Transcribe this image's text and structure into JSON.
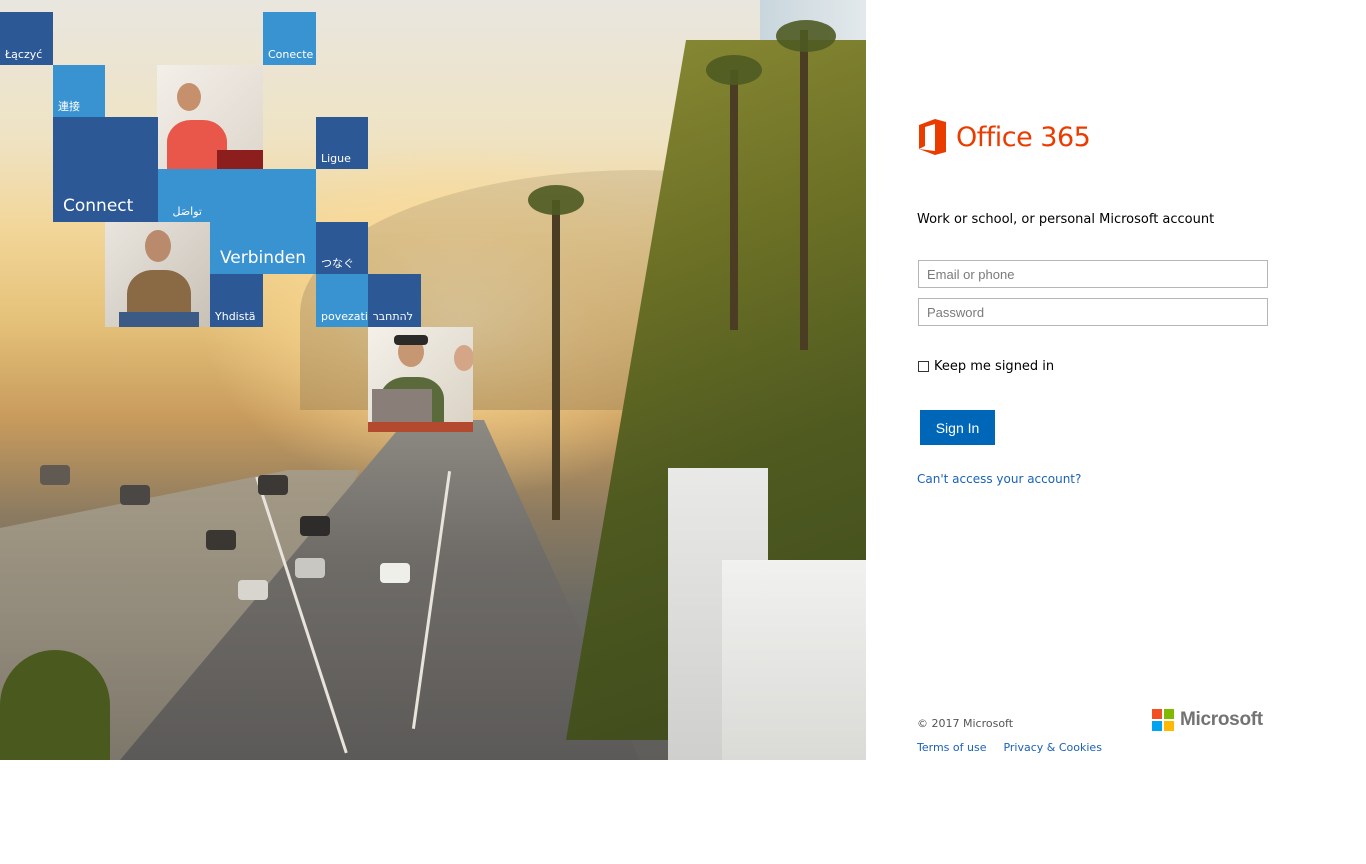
{
  "hero": {
    "tiles": [
      {
        "label": "Łączyć",
        "color": "#2c5896"
      },
      {
        "label": "Conecte",
        "color": "#3a93d1"
      },
      {
        "label": "連接",
        "color": "#3a93d1"
      },
      {
        "label": "Ligue",
        "color": "#2c5896"
      },
      {
        "label": "Connect",
        "color": "#2c5896"
      },
      {
        "label": "تواصَل",
        "color": "#3a93d1"
      },
      {
        "label": "Verbinden",
        "color": "#3a93d1"
      },
      {
        "label": "つなぐ",
        "color": "#2c5896"
      },
      {
        "label": "Yhdistä",
        "color": "#2c5896"
      },
      {
        "label": "povezati",
        "color": "#3a93d1"
      },
      {
        "label": "להתחבר",
        "color": "#2c5896"
      }
    ]
  },
  "brand": {
    "product_name": "Office 365",
    "accent": "#eb3c00",
    "icon": "office-icon"
  },
  "form": {
    "subtitle": "Work or school, or personal Microsoft account",
    "email_placeholder": "Email or phone",
    "email_value": "",
    "password_placeholder": "Password",
    "password_value": "",
    "keep_signed_in_label": "Keep me signed in",
    "keep_signed_in_checked": false,
    "sign_in_label": "Sign In",
    "sign_in_color": "#0067b8",
    "cant_access_label": "Can't access your account?"
  },
  "footer": {
    "copyright": "© 2017 Microsoft",
    "terms_label": "Terms of use",
    "privacy_label": "Privacy & Cookies",
    "ms_logo_text": "Microsoft",
    "ms_logo_colors": [
      "#f25022",
      "#7fba00",
      "#00a4ef",
      "#ffb900"
    ]
  }
}
